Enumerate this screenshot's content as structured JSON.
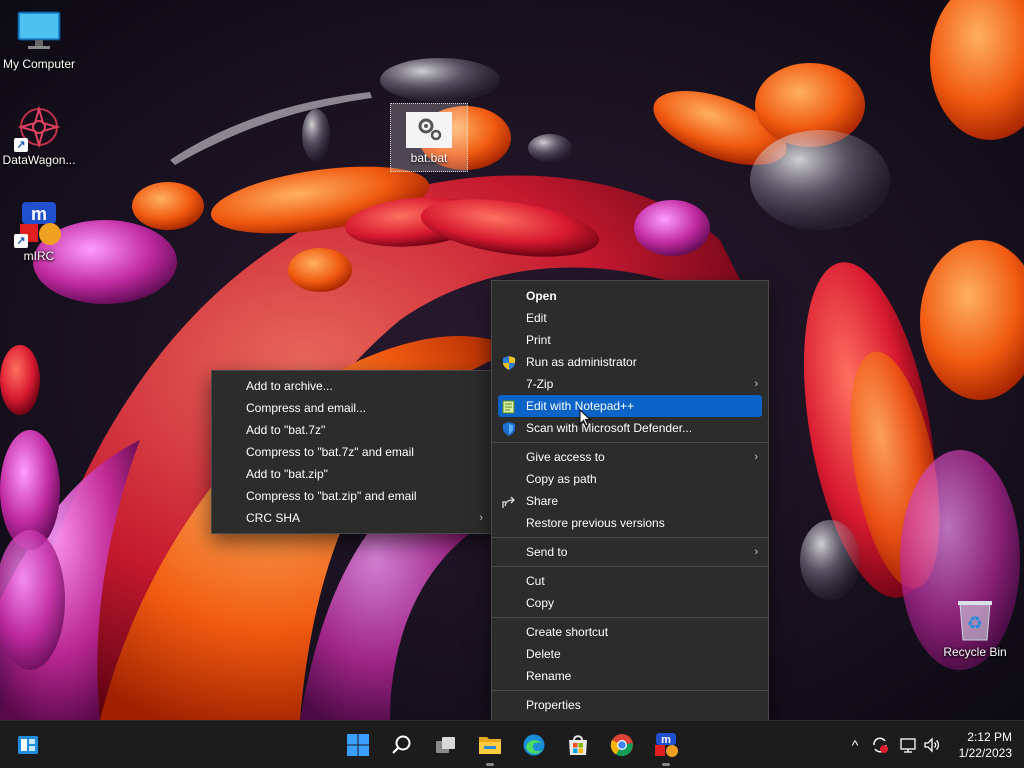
{
  "desktop": {
    "icons": [
      {
        "label": "My Computer",
        "icon": "monitor-icon"
      },
      {
        "label": "DataWagon...",
        "icon": "datawagon-icon"
      },
      {
        "label": "mIRC",
        "icon": "mirc-icon"
      },
      {
        "label": "Recycle Bin",
        "icon": "recycle-bin-icon"
      }
    ],
    "selected_file": {
      "label": "bat.bat",
      "icon": "gear-file-icon"
    }
  },
  "context_menu": {
    "items": [
      {
        "label": "Open"
      },
      {
        "label": "Edit"
      },
      {
        "label": "Print"
      },
      {
        "label": "Run as administrator",
        "icon": "shield-icon"
      },
      {
        "label": "7-Zip",
        "submenu": true
      },
      {
        "label": "Edit with Notepad++",
        "icon": "notepadpp-icon",
        "highlighted": true
      },
      {
        "label": "Scan with Microsoft Defender...",
        "icon": "defender-icon"
      },
      {
        "label": "Give access to",
        "submenu": true
      },
      {
        "label": "Copy as path"
      },
      {
        "label": "Share",
        "icon": "share-icon"
      },
      {
        "label": "Restore previous versions"
      },
      {
        "label": "Send to",
        "submenu": true
      },
      {
        "label": "Cut"
      },
      {
        "label": "Copy"
      },
      {
        "label": "Create shortcut"
      },
      {
        "label": "Delete"
      },
      {
        "label": "Rename"
      },
      {
        "label": "Properties"
      }
    ]
  },
  "zip_submenu": {
    "items": [
      {
        "label": "Add to archive..."
      },
      {
        "label": "Compress and email..."
      },
      {
        "label": "Add to \"bat.7z\""
      },
      {
        "label": "Compress to \"bat.7z\" and email"
      },
      {
        "label": "Add to \"bat.zip\""
      },
      {
        "label": "Compress to \"bat.zip\" and email"
      },
      {
        "label": "CRC SHA",
        "submenu": true
      }
    ]
  },
  "taskbar": {
    "apps": [
      "widgets-icon",
      "start-icon",
      "search-icon",
      "task-view-icon",
      "file-explorer-icon",
      "edge-icon",
      "store-icon",
      "chrome-icon",
      "mirc-icon"
    ],
    "tray": {
      "chevron": "^",
      "time": "2:12 PM",
      "date": "1/22/2023"
    }
  },
  "colors": {
    "highlight": "#0a64c8",
    "menu_bg": "#2c2c2c",
    "taskbar_bg": "#1c1c1c"
  }
}
